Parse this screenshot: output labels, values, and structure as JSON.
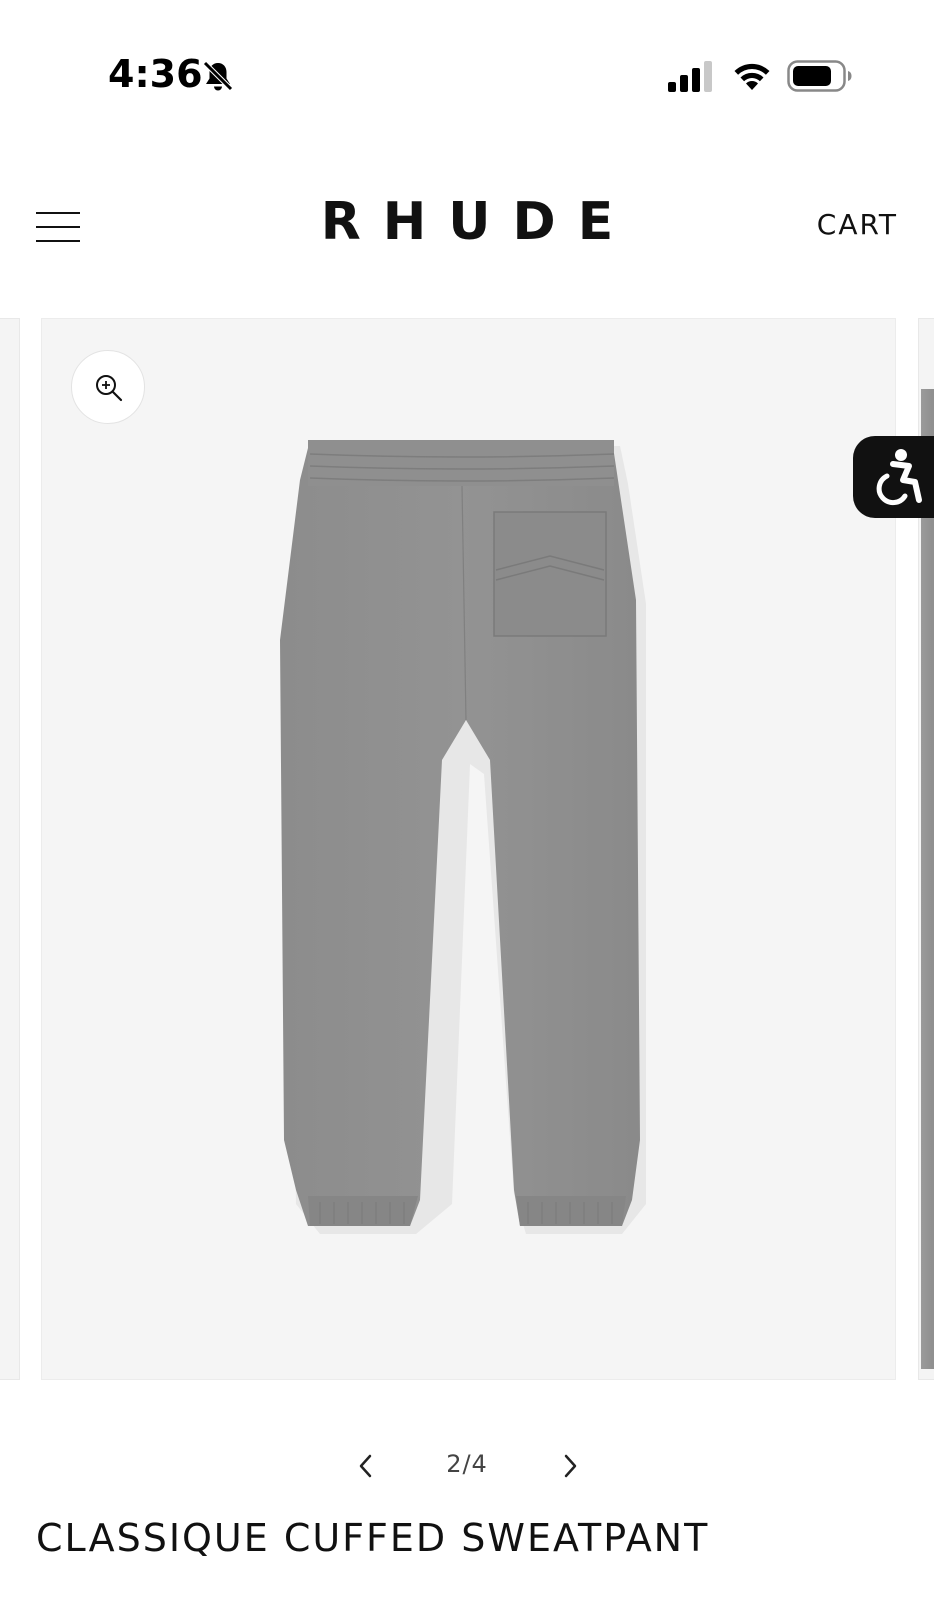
{
  "status_bar": {
    "time": "4:36",
    "icons": [
      "bell-slash-icon",
      "signal-icon",
      "wifi-icon",
      "battery-icon"
    ]
  },
  "header": {
    "brand": "RHUDE",
    "cart_label": "CART",
    "menu_icon": "hamburger-menu-icon"
  },
  "gallery": {
    "zoom_icon": "zoom-in-icon",
    "accessibility_icon": "accessibility-icon",
    "product_image": "grey sweatpant back view",
    "pager": "2/4",
    "prev_icon": "chevron-left-icon",
    "next_icon": "chevron-right-icon"
  },
  "product": {
    "title": "CLASSIQUE CUFFED SWEATPANT"
  },
  "colors": {
    "image_background": "#f5f5f5",
    "fabric": "#8e8e8e",
    "accent": "#111111"
  }
}
